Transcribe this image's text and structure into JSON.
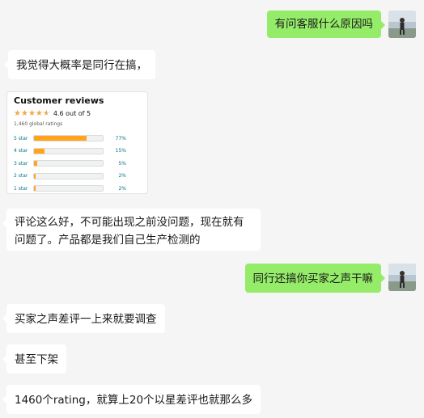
{
  "messages": [
    {
      "side": "out",
      "text": "有问客服什么原因吗"
    },
    {
      "side": "in",
      "text": "我觉得大概率是同行在搞，"
    },
    {
      "side": "in",
      "text": "评论这么好，不可能出现之前没问题，现在就有问题了。产品都是我们自己生产检测的"
    },
    {
      "side": "out",
      "text": "同行还搞你买家之声干嘛"
    },
    {
      "side": "in",
      "text": "买家之声差评一上来就要调查"
    },
    {
      "side": "in",
      "text": "甚至下架"
    },
    {
      "side": "in",
      "text": "1460个rating，就算上20个以星差评也就那么多"
    }
  ],
  "reviews": {
    "title": "Customer reviews",
    "score": "4.6 out of 5",
    "global_ratings": "1,460 global ratings",
    "star_color": "#f3a847",
    "bar_color": "#ffa41c",
    "rows": [
      {
        "label": "5 star",
        "percent": 77,
        "pct_text": "77%"
      },
      {
        "label": "4 star",
        "percent": 15,
        "pct_text": "15%"
      },
      {
        "label": "3 star",
        "percent": 5,
        "pct_text": "5%"
      },
      {
        "label": "2 star",
        "percent": 2,
        "pct_text": "2%"
      },
      {
        "label": "1 star",
        "percent": 2,
        "pct_text": "2%"
      }
    ]
  },
  "colors": {
    "out_bubble": "#95ec69",
    "in_bubble": "#ffffff",
    "background": "#f5f5f5"
  }
}
